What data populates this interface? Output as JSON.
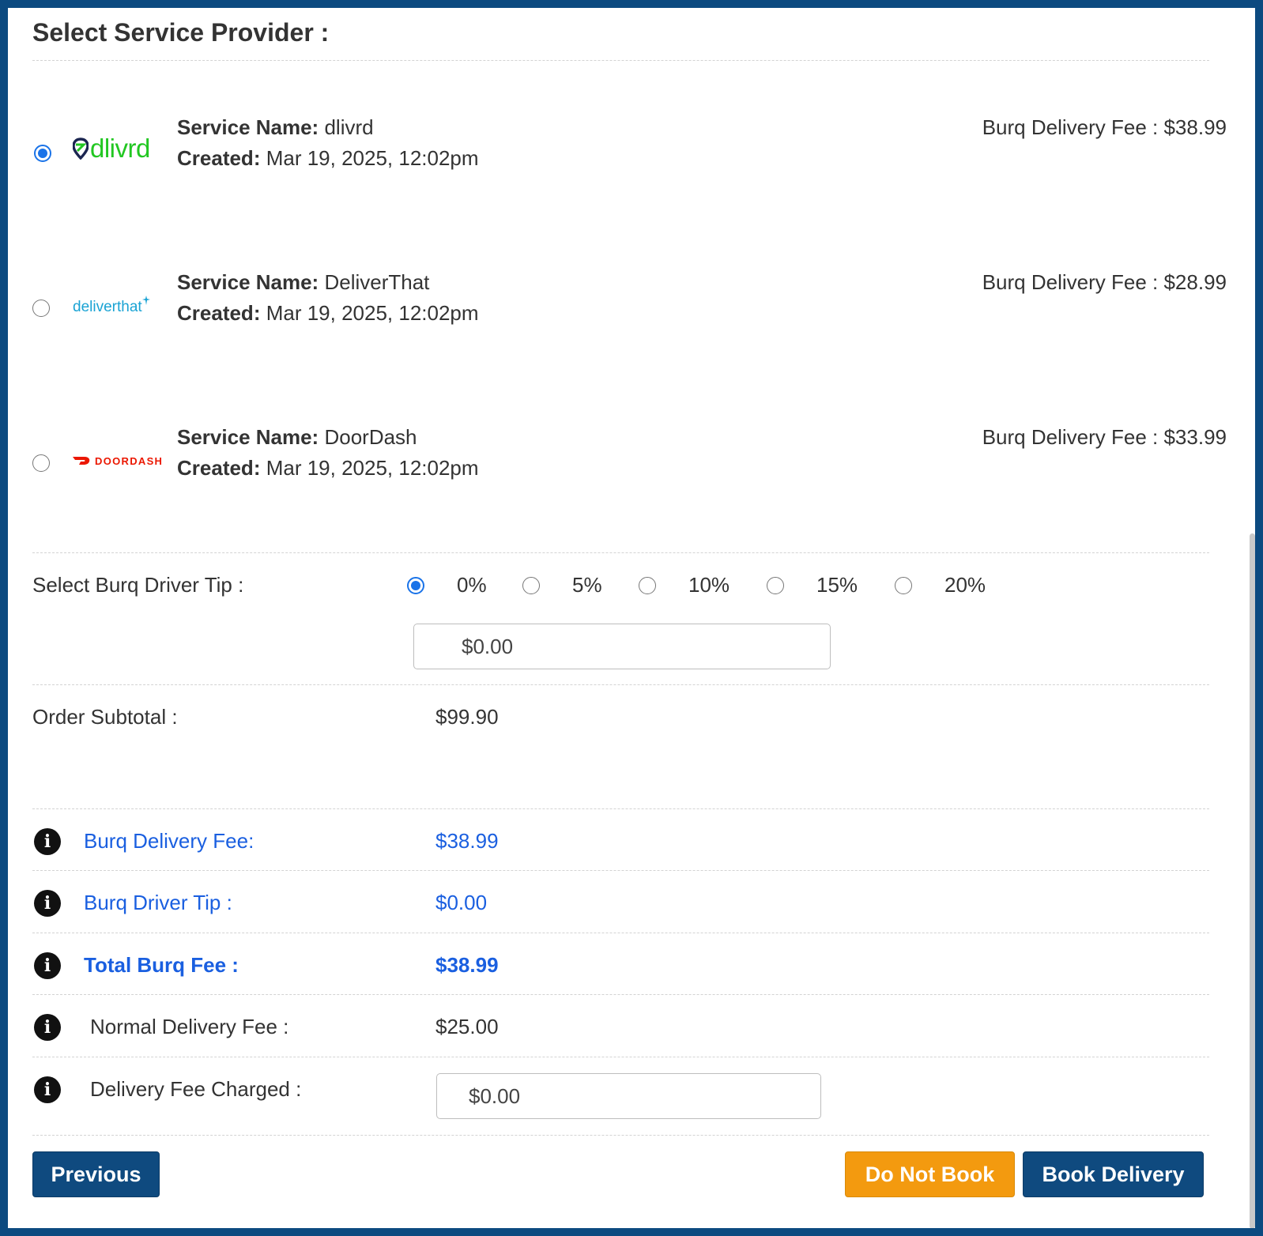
{
  "section_title": "Select Service Provider :",
  "providers": [
    {
      "logo_text": "dlivrd",
      "name_label": "Service Name:",
      "name": "dlivrd",
      "created_label": "Created:",
      "created": "Mar 19, 2025, 12:02pm",
      "fee": "Burq Delivery Fee : $38.99",
      "selected": true
    },
    {
      "logo_text": "deliverthat",
      "name_label": "Service Name:",
      "name": "DeliverThat",
      "created_label": "Created:",
      "created": "Mar 19, 2025, 12:02pm",
      "fee": "Burq Delivery Fee : $28.99",
      "selected": false
    },
    {
      "logo_text": "DOORDASH",
      "name_label": "Service Name:",
      "name": "DoorDash",
      "created_label": "Created:",
      "created": "Mar 19, 2025, 12:02pm",
      "fee": "Burq Delivery Fee : $33.99",
      "selected": false
    }
  ],
  "tip": {
    "label": "Select Burq Driver Tip :",
    "options": [
      "0%",
      "5%",
      "10%",
      "15%",
      "20%"
    ],
    "selected": "0%",
    "amount_value": "$0.00"
  },
  "subtotal": {
    "label": "Order Subtotal :",
    "value": "$99.90"
  },
  "fees": {
    "burq_delivery_fee": {
      "label": "Burq Delivery Fee:",
      "value": "$38.99"
    },
    "burq_driver_tip": {
      "label": "Burq Driver Tip :",
      "value": "$0.00"
    },
    "total_burq_fee": {
      "label": "Total Burq Fee :",
      "value": "$38.99"
    },
    "normal_delivery_fee": {
      "label": "Normal Delivery Fee :",
      "value": "$25.00"
    },
    "delivery_fee_charged": {
      "label": "Delivery Fee Charged :",
      "value": "$0.00"
    }
  },
  "info_icon_glyph": "i",
  "buttons": {
    "previous": "Previous",
    "do_not_book": "Do Not Book",
    "book_delivery": "Book Delivery"
  },
  "colors": {
    "frame": "#0c4a80",
    "accent_blue": "#1a5fe0",
    "primary_button": "#0f4a7f",
    "warning_button": "#f39a0f"
  }
}
